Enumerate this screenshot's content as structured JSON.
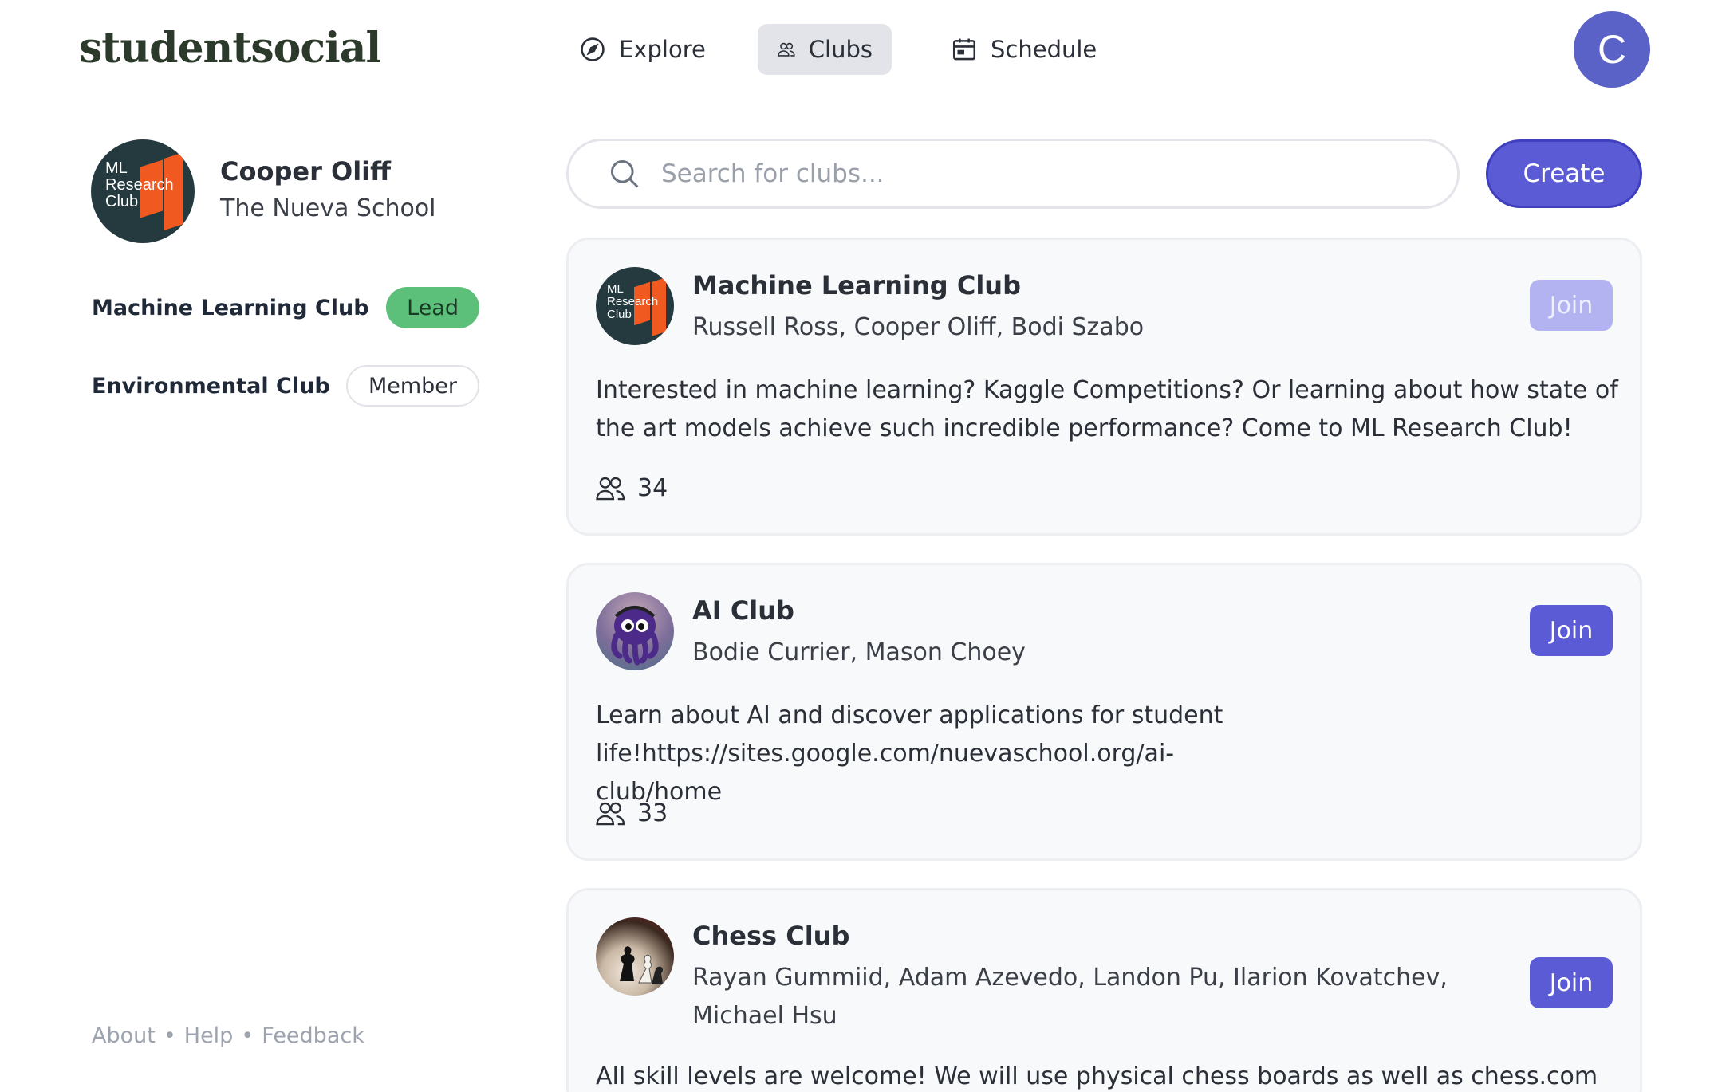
{
  "app": {
    "logo": "studentsocial"
  },
  "nav": {
    "items": [
      {
        "label": "Explore",
        "icon": "compass-icon"
      },
      {
        "label": "Clubs",
        "icon": "users-icon",
        "active": true
      },
      {
        "label": "Schedule",
        "icon": "calendar-icon"
      }
    ],
    "user_initial": "C"
  },
  "profile": {
    "name": "Cooper Oliff",
    "school": "The Nueva School",
    "avatar_text": [
      "ML",
      "Research",
      "Club"
    ],
    "clubs": [
      {
        "name": "Machine Learning Club",
        "role": "Lead"
      },
      {
        "name": "Environmental Club",
        "role": "Member"
      }
    ]
  },
  "footer": {
    "links": [
      "About",
      "Help",
      "Feedback"
    ],
    "separator": "•"
  },
  "search": {
    "placeholder": "Search for clubs..."
  },
  "create_label": "Create",
  "colors": {
    "accent": "#5b5bd6",
    "lead_badge": "#5cc07a",
    "avatar": "#5b62c7"
  },
  "clubs": [
    {
      "title": "Machine Learning Club",
      "leads": "Russell Ross, Cooper Oliff, Bodi Szabo",
      "description": "Interested in machine learning? Kaggle Competitions? Or learning about how state of the art models achieve such incredible performance? Come to ML Research Club!",
      "members": "34",
      "join_label": "Join",
      "join_disabled": true,
      "logo_text": [
        "ML",
        "Research",
        "Club"
      ]
    },
    {
      "title": "AI Club",
      "leads": "Bodie Currier, Mason Choey",
      "description": "Learn about AI and discover applications for student life!https://sites.google.com/nuevaschool.org/ai-club/home",
      "members": "33",
      "join_label": "Join",
      "join_disabled": false
    },
    {
      "title": "Chess Club",
      "leads": "Rayan Gummiid, Adam Azevedo, Landon Pu, Ilarion Kovatchev, Michael Hsu",
      "description": "All skill levels are welcome! We will use physical chess boards as well as chess.com and",
      "join_label": "Join",
      "join_disabled": false
    }
  ]
}
